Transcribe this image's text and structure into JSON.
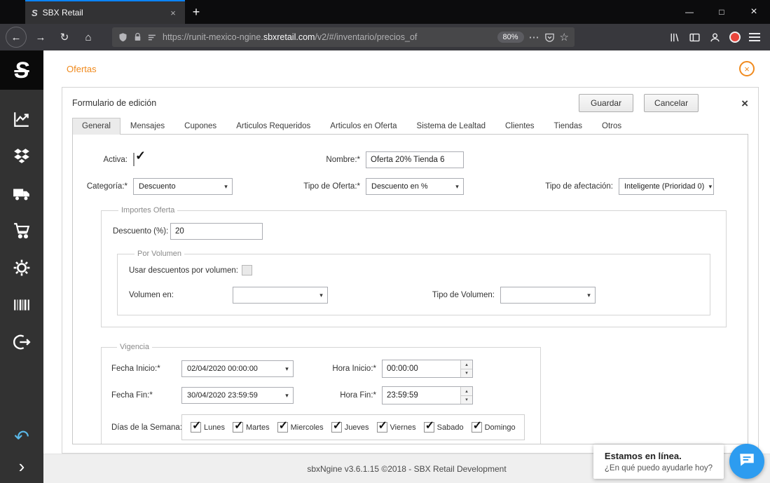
{
  "browser": {
    "tab_title": "SBX Retail",
    "url_prefix": "https://runit-mexico-ngine.",
    "url_domain": "sbxretail.com",
    "url_path": "/v2/#/inventario/precios_of",
    "zoom_level": "80%"
  },
  "glyphs": {
    "close": "×",
    "plus": "+",
    "minimize": "—",
    "maximize": "□",
    "back": "←",
    "forward": "→",
    "refresh": "↻",
    "home": "⌂",
    "ellipsis": "⋯",
    "star": "☆",
    "chevron_down": "▾",
    "chevron_up": "▴",
    "check": "✓",
    "undo": "↶",
    "chevron_right": "›"
  },
  "sidebar": {
    "logo_text": "S",
    "items": [
      "analytics",
      "apps",
      "shipping",
      "sales",
      "settings",
      "barcode",
      "logout"
    ]
  },
  "page": {
    "nav_tab": "Ofertas",
    "accent_color": "#f08a1d",
    "chat_button_color": "#2d9cf0",
    "form": {
      "title": "Formulario de edición",
      "save": "Guardar",
      "cancel": "Cancelar",
      "tabs": [
        "General",
        "Mensajes",
        "Cupones",
        "Articulos Requeridos",
        "Articulos en Oferta",
        "Sistema de Lealtad",
        "Clientes",
        "Tiendas",
        "Otros"
      ],
      "active_tab": "General",
      "activa_label": "Activa:",
      "activa_checked": true,
      "nombre_label": "Nombre:*",
      "nombre_value": "Oferta 20% Tienda 6",
      "categoria_label": "Categoría:*",
      "categoria_value": "Descuento",
      "tipo_oferta_label": "Tipo de Oferta:*",
      "tipo_oferta_value": "Descuento en %",
      "tipo_afectacion_label": "Tipo de afectación:",
      "tipo_afectacion_value": "Inteligente (Prioridad 0)",
      "importes": {
        "legend": "Importes Oferta",
        "descuento_label": "Descuento (%):",
        "descuento_value": "20",
        "por_volumen": {
          "legend": "Por Volumen",
          "usar_label": "Usar descuentos por volumen:",
          "usar_checked": false,
          "volumen_en_label": "Volumen en:",
          "volumen_en_value": "",
          "tipo_volumen_label": "Tipo de Volumen:",
          "tipo_volumen_value": ""
        }
      },
      "vigencia": {
        "legend": "Vigencia",
        "fecha_inicio_label": "Fecha Inicio:*",
        "fecha_inicio_value": "02/04/2020 00:00:00",
        "hora_inicio_label": "Hora Inicio:*",
        "hora_inicio_value": "00:00:00",
        "fecha_fin_label": "Fecha Fin:*",
        "fecha_fin_value": "30/04/2020 23:59:59",
        "hora_fin_label": "Hora Fin:*",
        "hora_fin_value": "23:59:59",
        "dias_label": "Días de la Semana:",
        "dias": [
          {
            "label": "Lunes",
            "checked": true
          },
          {
            "label": "Martes",
            "checked": true
          },
          {
            "label": "Miercoles",
            "checked": true
          },
          {
            "label": "Jueves",
            "checked": true
          },
          {
            "label": "Viernes",
            "checked": true
          },
          {
            "label": "Sabado",
            "checked": true
          },
          {
            "label": "Domingo",
            "checked": true
          }
        ]
      }
    },
    "footer": "sbxNgine v3.6.1.15 ©2018 - SBX Retail Development",
    "chat": {
      "status": "Estamos en línea.",
      "question": "¿En qué puedo ayudarle hoy?"
    }
  }
}
